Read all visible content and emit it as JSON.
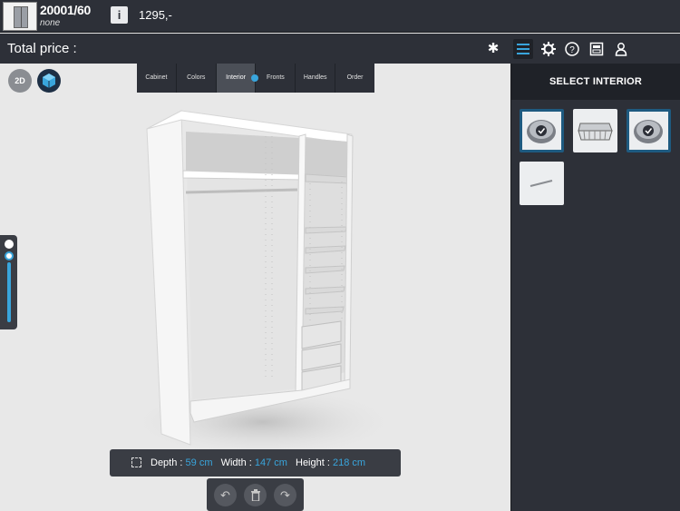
{
  "header": {
    "article_number": "20001/60",
    "article_sub": "none",
    "info_label": "i",
    "price": "1295,-"
  },
  "toolbar": {
    "total_label": "Total price :",
    "icons": [
      "asterisk-icon",
      "list-icon",
      "gear-icon",
      "help-icon",
      "print-icon",
      "user-icon"
    ]
  },
  "view": {
    "mode_2d_label": "2D",
    "tabs": [
      {
        "label": "Cabinet"
      },
      {
        "label": "Colors"
      },
      {
        "label": "Interior"
      },
      {
        "label": "Fronts"
      },
      {
        "label": "Handles"
      },
      {
        "label": "Order"
      }
    ],
    "active_tab": "Interior",
    "dimensions": {
      "depth_label": "Depth :",
      "depth_value": "59 cm",
      "width_label": "Width :",
      "width_value": "147 cm",
      "height_label": "Height :",
      "height_value": "218 cm"
    },
    "actions": {
      "undo_glyph": "↶",
      "delete_glyph": "🗑",
      "redo_glyph": "↷"
    }
  },
  "panel": {
    "title": "SELECT INTERIOR",
    "items": [
      {
        "name": "interior-item-1",
        "selected": true
      },
      {
        "name": "interior-item-2",
        "selected": false
      },
      {
        "name": "interior-item-3",
        "selected": true
      },
      {
        "name": "interior-item-4",
        "selected": false
      }
    ]
  },
  "colors": {
    "accent": "#39a5dc",
    "bar": "#2d3038",
    "canvas": "#e8e8e8"
  }
}
